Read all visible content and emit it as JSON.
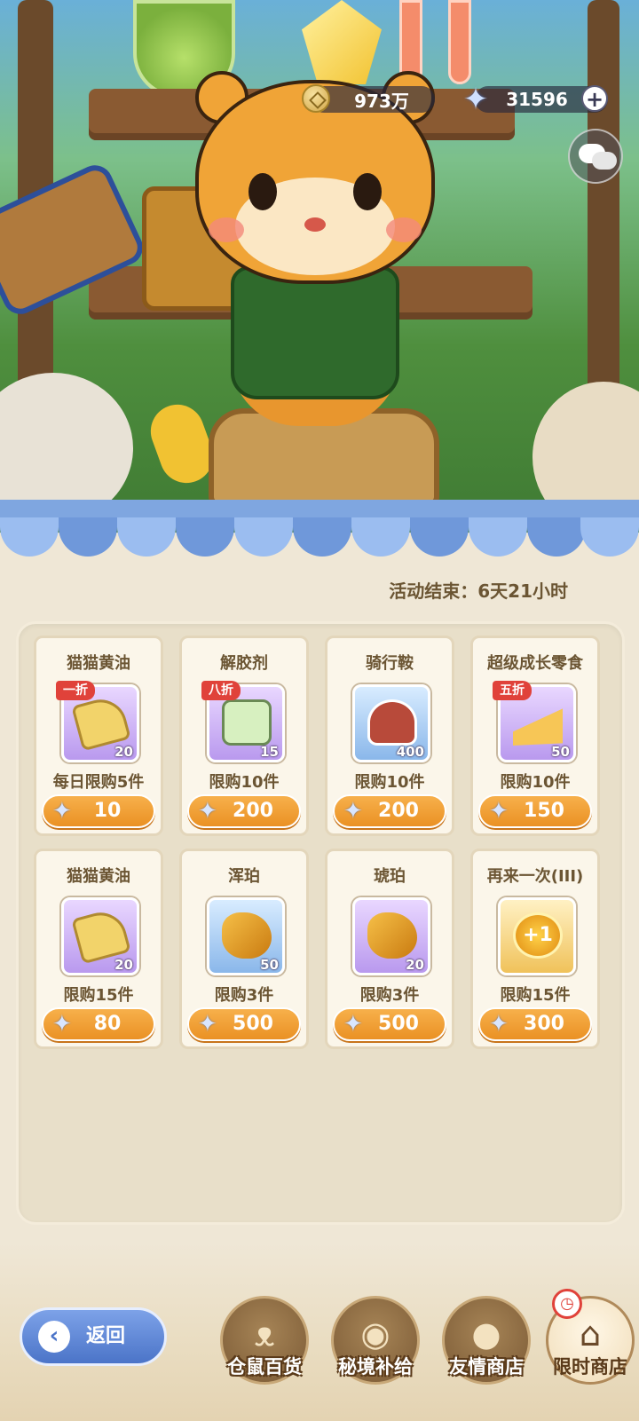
{
  "hud": {
    "coins": "973万",
    "stars": "31596",
    "plus_label": "+"
  },
  "shop": {
    "timer_label": "活动结束：6天21小时",
    "items": [
      {
        "name": "猫猫黄油",
        "badge": "一折",
        "qty": "20",
        "limit": "每日限购5件",
        "price": "10",
        "frame": "purple",
        "art": "butter"
      },
      {
        "name": "解胶剂",
        "badge": "八折",
        "qty": "15",
        "limit": "限购10件",
        "price": "200",
        "frame": "purple",
        "art": "bottle"
      },
      {
        "name": "骑行鞍",
        "badge": "",
        "qty": "400",
        "limit": "限购10件",
        "price": "200",
        "frame": "blue",
        "art": "saddle"
      },
      {
        "name": "超级成长零食",
        "badge": "五折",
        "qty": "50",
        "limit": "限购10件",
        "price": "150",
        "frame": "purple",
        "art": "cheese"
      },
      {
        "name": "猫猫黄油",
        "badge": "",
        "qty": "20",
        "limit": "限购15件",
        "price": "80",
        "frame": "purple",
        "art": "butter"
      },
      {
        "name": "浑珀",
        "badge": "",
        "qty": "50",
        "limit": "限购3件",
        "price": "500",
        "frame": "blue",
        "art": "amber"
      },
      {
        "name": "琥珀",
        "badge": "",
        "qty": "20",
        "limit": "限购3件",
        "price": "500",
        "frame": "purple",
        "art": "amber"
      },
      {
        "name": "再来一次(III)",
        "badge": "",
        "qty": "",
        "limit": "限购15件",
        "price": "300",
        "frame": "gold",
        "art": "token"
      }
    ]
  },
  "token_text": "+1",
  "nav": {
    "back_label": "返回",
    "tabs": [
      {
        "label": "仓鼠百货",
        "icon": "hamster-icon",
        "active": false
      },
      {
        "label": "秘境补给",
        "icon": "eye-emblem-icon",
        "active": false
      },
      {
        "label": "友情商店",
        "icon": "orb-icon",
        "active": false
      },
      {
        "label": "限时商店",
        "icon": "stall-icon",
        "active": true
      }
    ]
  },
  "colors": {
    "accent_orange": "#ea9124",
    "badge_red": "#e0423a",
    "panel": "#e8dfc9",
    "awning_blue": "#7fa6e0"
  }
}
